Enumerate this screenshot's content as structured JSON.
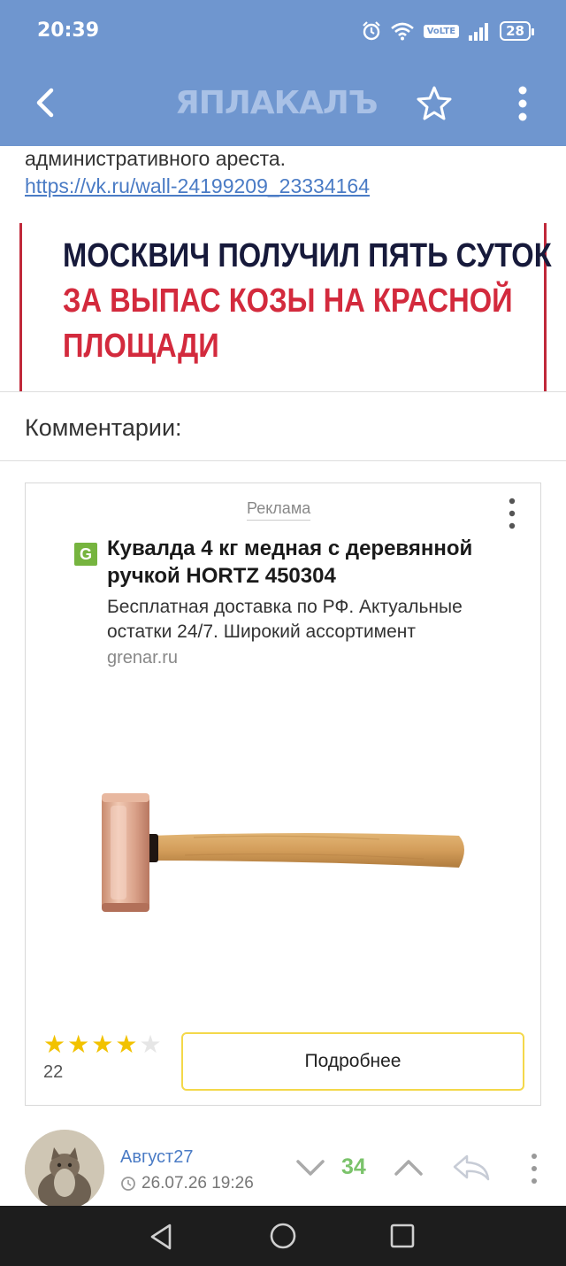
{
  "status_bar": {
    "time": "20:39",
    "volte": "VoLTE",
    "battery": "28"
  },
  "nav": {
    "logo": "ЯПЛАКАЛЪ"
  },
  "article": {
    "text": "административного ареста.",
    "link": "https://vk.ru/wall-24199209_23334164",
    "headline_line1": "МОСКВИЧ ПОЛУЧИЛ ПЯТЬ СУТОК",
    "headline_line2": "ЗА ВЫПАС КОЗЫ НА КРАСНОЙ",
    "headline_line3": "ПЛОЩАДИ"
  },
  "comments": {
    "title": "Комментарии:"
  },
  "ad": {
    "label": "Реклама",
    "badge": "G",
    "title": "Кувалда 4 кг медная с деревянной ручкой HORTZ 450304",
    "description": "Бесплатная доставка по РФ. Актуальные остатки 24/7. Широкий ассортимент",
    "domain": "grenar.ru",
    "rating": 4,
    "rating_max": 5,
    "rating_count": "22",
    "cta": "Подробнее"
  },
  "comment": {
    "author": "Август27",
    "date": "26.07.26 19:26",
    "score": "34"
  },
  "colors": {
    "header": "#6f96cf",
    "link": "#4a7bc5",
    "score": "#7bc36b",
    "headline_red": "#d32a3d",
    "headline_dark": "#171a3b",
    "star": "#f2c200"
  }
}
